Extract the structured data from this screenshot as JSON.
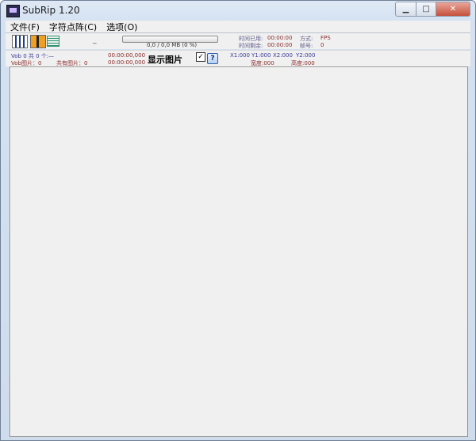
{
  "window": {
    "title": "SubRip 1.20",
    "controls": {
      "minimize": "▁",
      "maximize": "□",
      "close": "✕"
    }
  },
  "menu": [
    {
      "label": "文件(F)"
    },
    {
      "label": "字符点阵(C)"
    },
    {
      "label": "选项(O)"
    }
  ],
  "toolbar": {
    "icons": [
      "vob-icon",
      "split-icon",
      "matrix-icon"
    ],
    "dash": "_",
    "progress": {
      "percent": 0,
      "text": "0,0 / 0,0 MB (0 %)"
    },
    "time_used_label": "时间已用:",
    "time_used_value": "00:00:00",
    "time_left_label": "时间剩余:",
    "time_left_value": "00:00:00",
    "mode_label": "方式:",
    "mode_value": "FPS",
    "frame_label": "帧号:",
    "frame_value": "0"
  },
  "info": {
    "vob_count": "Vob 0 共 0 个:—",
    "vob_image": "Vob图片：0",
    "total_images": "共有图片：0",
    "time_start": "00:00:00,000",
    "time_end": "00:00:00,000",
    "show_image_label": "显示图片",
    "show_image_checked": "✓",
    "help_label": "?",
    "x1": "X1:000",
    "y1": "Y1:000",
    "x2": "X2:000",
    "y2": "Y2:000",
    "width_label": "宽度:000",
    "height_label": "高度:000"
  },
  "colors": {
    "chrome": "#d3e1f1",
    "panel": "#f0f0f0",
    "value_red": "#8b2b2b",
    "label_blue": "#3b3b9b",
    "close_red": "#c6503b"
  }
}
